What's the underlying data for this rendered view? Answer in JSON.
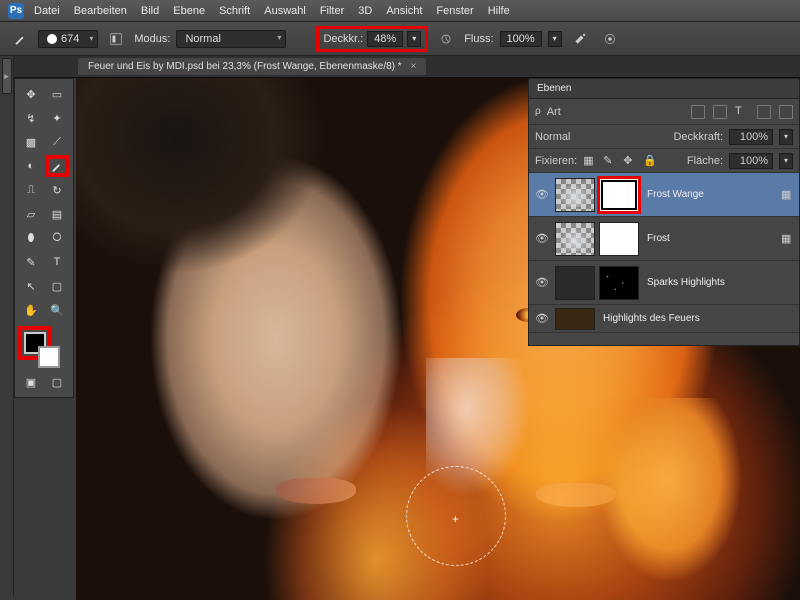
{
  "app": {
    "logo": "Ps"
  },
  "menu": [
    "Datei",
    "Bearbeiten",
    "Bild",
    "Ebene",
    "Schrift",
    "Auswahl",
    "Filter",
    "3D",
    "Ansicht",
    "Fenster",
    "Hilfe"
  ],
  "optbar": {
    "brush_size": "674",
    "mode_label": "Modus:",
    "mode_value": "Normal",
    "opacity_label": "Deckkr.:",
    "opacity_value": "48%",
    "flow_label": "Fluss:",
    "flow_value": "100%"
  },
  "tab": {
    "title": "Feuer und Eis by MDI.psd bei 23,3% (Frost Wange, Ebenenmaske/8) *"
  },
  "layers_panel": {
    "title": "Ebenen",
    "filter_kind_label": "Art",
    "blend_mode": "Normal",
    "opacity_label": "Deckkraft:",
    "opacity_value": "100%",
    "lock_label": "Fixieren:",
    "fill_label": "Fläche:",
    "fill_value": "100%",
    "layers": [
      {
        "name": "Frost Wange",
        "selected": true,
        "mask_highlight": true
      },
      {
        "name": "Frost",
        "selected": false,
        "mask_highlight": false
      },
      {
        "name": "Sparks Highlights",
        "selected": false,
        "mask_dark": true
      },
      {
        "name": "Highlights des Feuers",
        "selected": false,
        "partial": true
      }
    ]
  },
  "canvas": {
    "cursor_shape": "circle-brush"
  }
}
